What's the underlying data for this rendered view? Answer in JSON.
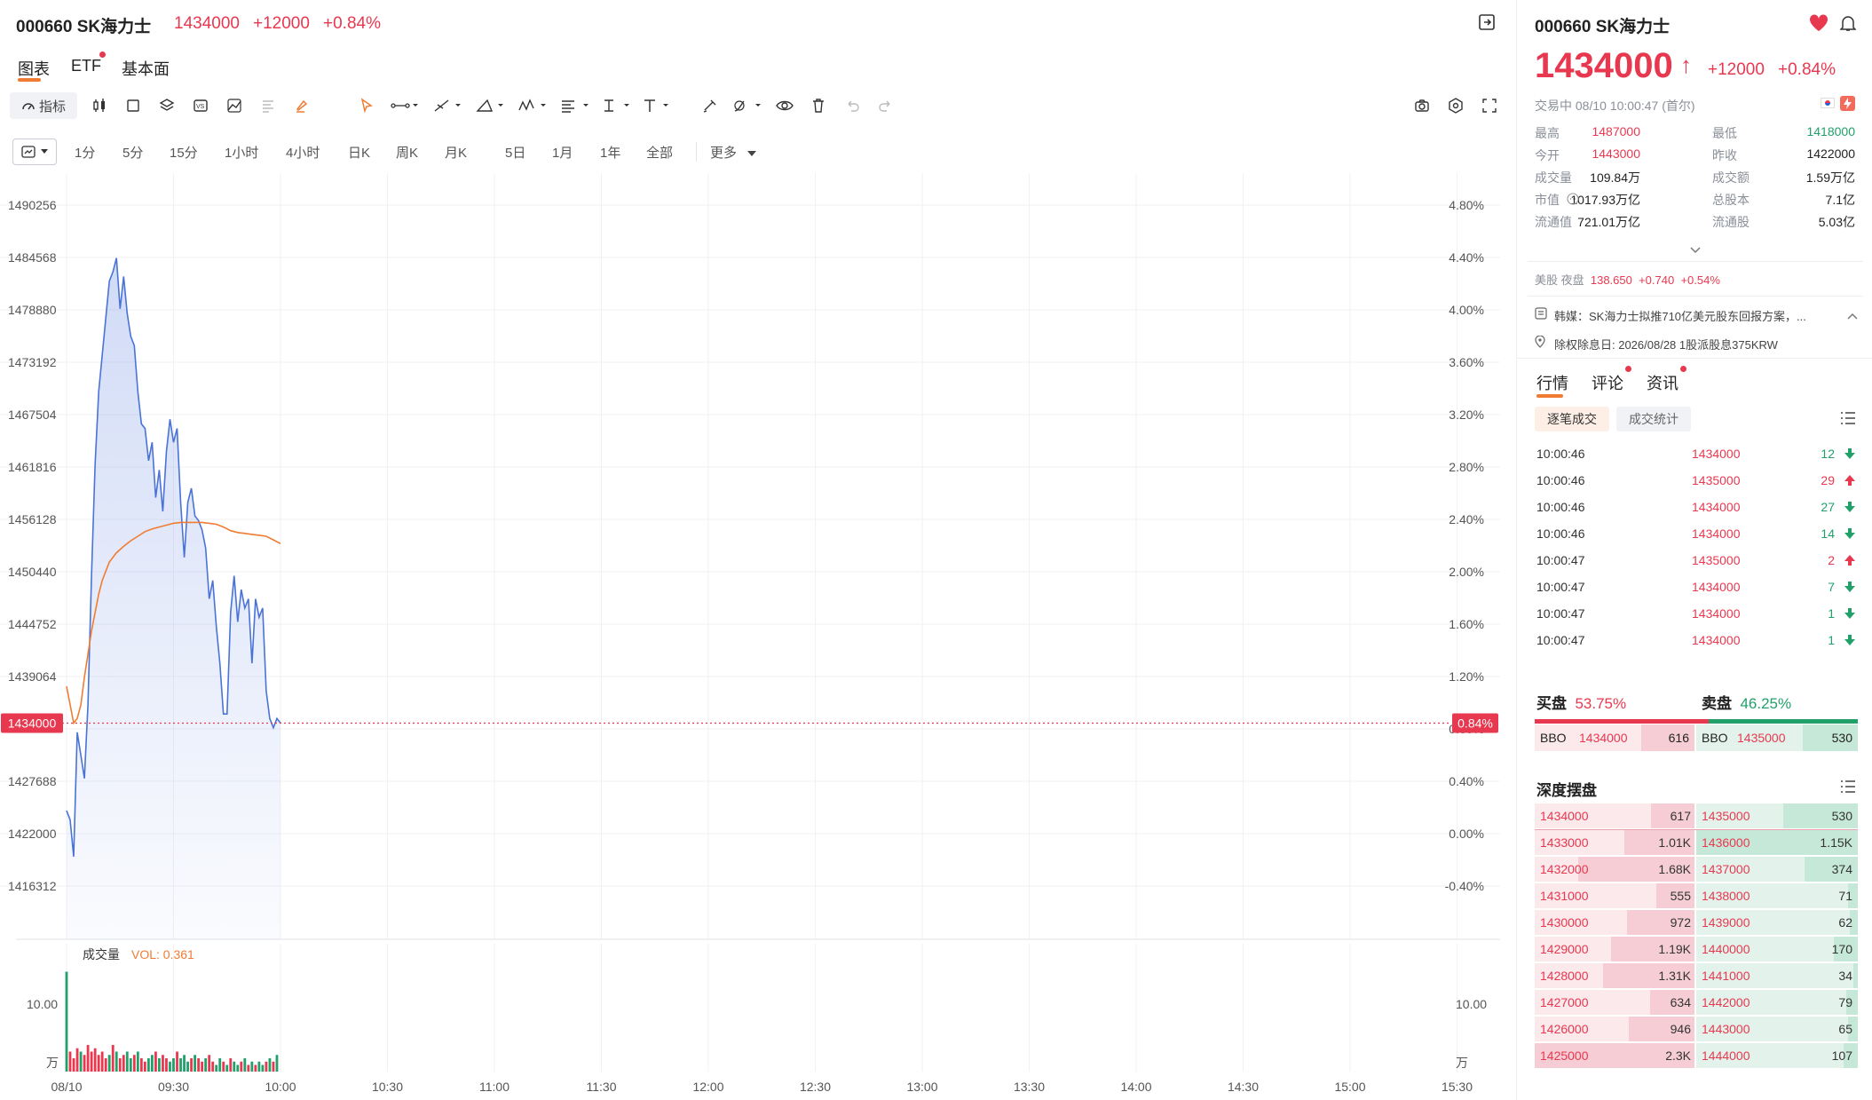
{
  "stock": {
    "code": "000660",
    "name": "SK海力士",
    "price": "1434000",
    "change": "+12000",
    "change_pct": "+0.84%"
  },
  "chart_tabs": [
    "图表",
    "ETF",
    "基本面"
  ],
  "toolbar": {
    "indicator_label": "指标"
  },
  "periods": [
    "1分",
    "5分",
    "15分",
    "1小时",
    "4小时",
    "日K",
    "周K",
    "月K",
    "5日",
    "1月",
    "1年",
    "全部",
    "更多"
  ],
  "chart_data": {
    "type": "line",
    "title": "",
    "price_axis": {
      "ticks": [
        1490256,
        1484568,
        1478880,
        1473192,
        1467504,
        1461816,
        1456128,
        1450440,
        1444752,
        1439064,
        1427688,
        1422000,
        1416312
      ],
      "min": 1413000,
      "max": 1492000
    },
    "pct_axis": {
      "ticks": [
        "4.80%",
        "4.40%",
        "4.00%",
        "3.60%",
        "3.20%",
        "2.80%",
        "2.40%",
        "2.00%",
        "1.60%",
        "1.20%",
        "0.80%",
        "0.40%",
        "0.00%",
        "-0.40%"
      ]
    },
    "x_ticks": [
      "08/10",
      "09:30",
      "10:00",
      "10:30",
      "11:00",
      "11:30",
      "12:00",
      "12:30",
      "13:00",
      "13:30",
      "14:00",
      "14:30",
      "15:00",
      "15:30"
    ],
    "current_price_label": "1434000",
    "current_pct_label": "0.84%",
    "prev_close": 1422000,
    "series": [
      {
        "name": "",
        "color": "#4a73d8",
        "x": [
          0,
          1,
          2,
          3,
          4,
          5,
          6,
          7,
          8,
          9,
          10,
          11,
          12,
          13,
          14,
          15,
          16,
          17,
          18,
          19,
          20,
          21,
          22,
          23,
          24,
          25,
          26,
          27,
          28,
          29,
          30,
          31,
          32,
          33,
          34,
          35,
          36,
          37,
          38,
          39,
          40,
          41,
          42,
          43,
          44,
          45,
          46,
          47,
          48,
          49,
          50,
          51,
          52,
          53,
          54,
          55,
          56,
          57,
          58,
          59,
          60
        ],
        "values": [
          1424500,
          1423500,
          1419500,
          1433000,
          1430500,
          1428000,
          1436000,
          1450000,
          1462000,
          1470000,
          1474000,
          1478000,
          1482000,
          1483000,
          1484500,
          1479000,
          1482500,
          1478500,
          1476000,
          1475000,
          1470000,
          1466500,
          1466000,
          1462500,
          1464500,
          1458500,
          1461500,
          1457000,
          1463500,
          1467000,
          1464500,
          1466000,
          1458000,
          1452000,
          1458000,
          1459500,
          1456500,
          1456000,
          1455000,
          1453000,
          1447500,
          1449500,
          1444500,
          1440500,
          1435000,
          1435000,
          1446000,
          1450000,
          1445000,
          1448500,
          1446500,
          1447500,
          1440500,
          1447500,
          1445500,
          1446500,
          1437500,
          1434500,
          1433500,
          1434500,
          1434000
        ]
      },
      {
        "name": "",
        "color": "#f07c34",
        "x": [
          0,
          1,
          2,
          3,
          4,
          5,
          6,
          7,
          8,
          9,
          10,
          11,
          12,
          14,
          16,
          18,
          20,
          22,
          24,
          26,
          28,
          30,
          32,
          34,
          36,
          38,
          40,
          42,
          44,
          46,
          48,
          50,
          52,
          54,
          56,
          58,
          60
        ],
        "values": [
          1438000,
          1436000,
          1434000,
          1434500,
          1436000,
          1439000,
          1441500,
          1444000,
          1446000,
          1448000,
          1449500,
          1450500,
          1451500,
          1452500,
          1453200,
          1453800,
          1454300,
          1454800,
          1455100,
          1455300,
          1455500,
          1455700,
          1455800,
          1455800,
          1455800,
          1455800,
          1455700,
          1455600,
          1455300,
          1454900,
          1454700,
          1454600,
          1454500,
          1454400,
          1454300,
          1453900,
          1453500
        ]
      }
    ]
  },
  "volume": {
    "label": "成交量",
    "vol_text": "VOL: 0.361",
    "y_left": "10.00",
    "y_right": "10.00",
    "unit": "万",
    "bars": [
      1.5,
      0.3,
      0.2,
      0.35,
      0.3,
      0.25,
      0.4,
      0.3,
      0.35,
      0.25,
      0.3,
      0.2,
      0.25,
      0.4,
      0.3,
      0.2,
      0.25,
      0.3,
      0.2,
      0.25,
      0.3,
      0.2,
      0.15,
      0.2,
      0.25,
      0.3,
      0.2,
      0.25,
      0.2,
      0.15,
      0.2,
      0.3,
      0.2,
      0.25,
      0.15,
      0.2,
      0.25,
      0.2,
      0.15,
      0.2,
      0.25,
      0.15,
      0.1,
      0.2,
      0.15,
      0.1,
      0.2,
      0.15,
      0.1,
      0.15,
      0.2,
      0.1,
      0.15,
      0.1,
      0.15,
      0.1,
      0.15,
      0.2,
      0.15,
      0.25
    ],
    "bar_colors": [
      "#21a06a",
      "#e8384f",
      "#e8384f",
      "#e8384f",
      "#21a06a",
      "#e8384f",
      "#e8384f",
      "#e8384f",
      "#e8384f",
      "#e8384f",
      "#e8384f",
      "#e8384f",
      "#21a06a",
      "#e8384f",
      "#21a06a",
      "#e8384f",
      "#e8384f",
      "#21a06a",
      "#21a06a",
      "#e8384f",
      "#21a06a",
      "#e8384f",
      "#e8384f",
      "#21a06a",
      "#21a06a",
      "#e8384f",
      "#21a06a",
      "#e8384f",
      "#e8384f",
      "#21a06a",
      "#21a06a",
      "#e8384f",
      "#21a06a",
      "#21a06a",
      "#21a06a",
      "#e8384f",
      "#21a06a",
      "#e8384f",
      "#e8384f",
      "#21a06a",
      "#e8384f",
      "#e8384f",
      "#21a06a",
      "#21a06a",
      "#e8384f",
      "#21a06a",
      "#e8384f",
      "#21a06a",
      "#21a06a",
      "#e8384f",
      "#21a06a",
      "#e8384f",
      "#21a06a",
      "#e8384f",
      "#21a06a",
      "#21a06a",
      "#e8384f",
      "#21a06a",
      "#e8384f",
      "#21a06a"
    ]
  },
  "right": {
    "code": "000660",
    "name": "SK海力士",
    "price": "1434000",
    "arrow": "↑",
    "change": "+12000",
    "change_pct": "+0.84%",
    "status": "交易中 08/10 10:00:47 (首尔)",
    "stats": [
      {
        "l1": "最高",
        "v1": "1487000",
        "c1": "red",
        "l2": "最低",
        "v2": "1418000",
        "c2": "green"
      },
      {
        "l1": "今开",
        "v1": "1443000",
        "c1": "red",
        "l2": "昨收",
        "v2": "1422000",
        "c2": "dark"
      },
      {
        "l1": "成交量",
        "v1": "109.84万",
        "c1": "dark",
        "l2": "成交额",
        "v2": "1.59万亿",
        "c2": "dark"
      },
      {
        "l1": "市值",
        "v1": "1017.93万亿",
        "c1": "dark",
        "l2": "总股本",
        "v2": "7.1亿",
        "c2": "dark"
      },
      {
        "l1": "流通值",
        "v1": "721.01万亿",
        "c1": "dark",
        "l2": "流通股",
        "v2": "5.03亿",
        "c2": "dark"
      }
    ],
    "us": {
      "label": "美股 夜盘",
      "price": "138.650",
      "chg": "+0.740",
      "pct": "+0.54%"
    },
    "news": "韩媒：SK海力士拟推710亿美元股东回报方案，...",
    "dividend": "除权除息日: 2026/08/28 1股派股息375KRW",
    "tabs": [
      "行情",
      "评论",
      "资讯"
    ],
    "subtabs": [
      "逐笔成交",
      "成交统计"
    ],
    "ticks": [
      {
        "t": "10:00:46",
        "p": "1434000",
        "v": "12",
        "d": "down"
      },
      {
        "t": "10:00:46",
        "p": "1435000",
        "v": "29",
        "d": "up"
      },
      {
        "t": "10:00:46",
        "p": "1434000",
        "v": "27",
        "d": "down"
      },
      {
        "t": "10:00:46",
        "p": "1434000",
        "v": "14",
        "d": "down"
      },
      {
        "t": "10:00:47",
        "p": "1435000",
        "v": "2",
        "d": "up"
      },
      {
        "t": "10:00:47",
        "p": "1434000",
        "v": "7",
        "d": "down"
      },
      {
        "t": "10:00:47",
        "p": "1434000",
        "v": "1",
        "d": "down"
      },
      {
        "t": "10:00:47",
        "p": "1434000",
        "v": "1",
        "d": "down"
      }
    ],
    "buy_label": "买盘",
    "buy_pct": "53.75%",
    "sell_label": "卖盘",
    "sell_pct": "46.25%",
    "buy_frac": 0.5375,
    "bbo": {
      "buy": {
        "label": "BBO",
        "price": "1434000",
        "vol": "616"
      },
      "sell": {
        "label": "BBO",
        "price": "1435000",
        "vol": "530"
      }
    },
    "depth_title": "深度摆盘",
    "depth": [
      {
        "bp": "1434000",
        "bv": "617",
        "bf": 0.27,
        "ap": "1435000",
        "av": "530",
        "af": 0.46
      },
      {
        "bp": "1433000",
        "bv": "1.01K",
        "bf": 0.44,
        "ap": "1436000",
        "av": "1.15K",
        "af": 1.0
      },
      {
        "bp": "1432000",
        "bv": "1.68K",
        "bf": 0.73,
        "ap": "1437000",
        "av": "374",
        "af": 0.33
      },
      {
        "bp": "1431000",
        "bv": "555",
        "bf": 0.24,
        "ap": "1438000",
        "av": "71",
        "af": 0.06
      },
      {
        "bp": "1430000",
        "bv": "972",
        "bf": 0.42,
        "ap": "1439000",
        "av": "62",
        "af": 0.05
      },
      {
        "bp": "1429000",
        "bv": "1.19K",
        "bf": 0.52,
        "ap": "1440000",
        "av": "170",
        "af": 0.15
      },
      {
        "bp": "1428000",
        "bv": "1.31K",
        "bf": 0.57,
        "ap": "1441000",
        "av": "34",
        "af": 0.03
      },
      {
        "bp": "1427000",
        "bv": "634",
        "bf": 0.28,
        "ap": "1442000",
        "av": "79",
        "af": 0.07
      },
      {
        "bp": "1426000",
        "bv": "946",
        "bf": 0.41,
        "ap": "1443000",
        "av": "65",
        "af": 0.06
      },
      {
        "bp": "1425000",
        "bv": "2.3K",
        "bf": 1.0,
        "ap": "1444000",
        "av": "107",
        "af": 0.09
      }
    ]
  }
}
